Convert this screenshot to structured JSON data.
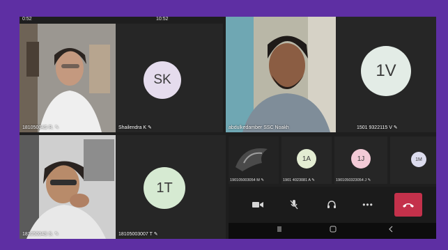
{
  "status": {
    "time": "0:52",
    "right": "10:52"
  },
  "tiles": {
    "top_left_video": {
      "label": "18105004S R. ✎"
    },
    "sk": {
      "initials": "SK",
      "label": "Shailendra K ✎"
    },
    "speaker_video": {
      "label": "abdulkedamber SSC Noakh"
    },
    "1v": {
      "initials": "1V",
      "label": "1501 9322115 V ✎"
    },
    "bottom_left_video": {
      "label": "18105004S S. ✎"
    },
    "1t": {
      "initials": "1T",
      "label": "18105003007 T ✎"
    }
  },
  "strip": [
    {
      "label": "190105003054 M ✎"
    },
    {
      "initials": "1A",
      "label": "1901 4023081 A ✎"
    },
    {
      "initials": "1J",
      "label": "1901050323054 J ✎"
    },
    {
      "initials": "1M",
      "label": ""
    }
  ],
  "controls": {
    "camera": "camera-icon",
    "mic": "mic-off-icon",
    "audio": "headset-icon",
    "more": "•••",
    "hangup": "phone-hangup-icon"
  },
  "colors": {
    "border": "#5e2fa3",
    "avatar_sk": "#e5dced",
    "avatar_1v": "#e3ece6",
    "avatar_1t": "#d6ead2",
    "avatar_1a": "#e3ecd2",
    "avatar_1j": "#f2cad6",
    "avatar_1m": "#dcdcee",
    "hangup": "#c4314b"
  }
}
